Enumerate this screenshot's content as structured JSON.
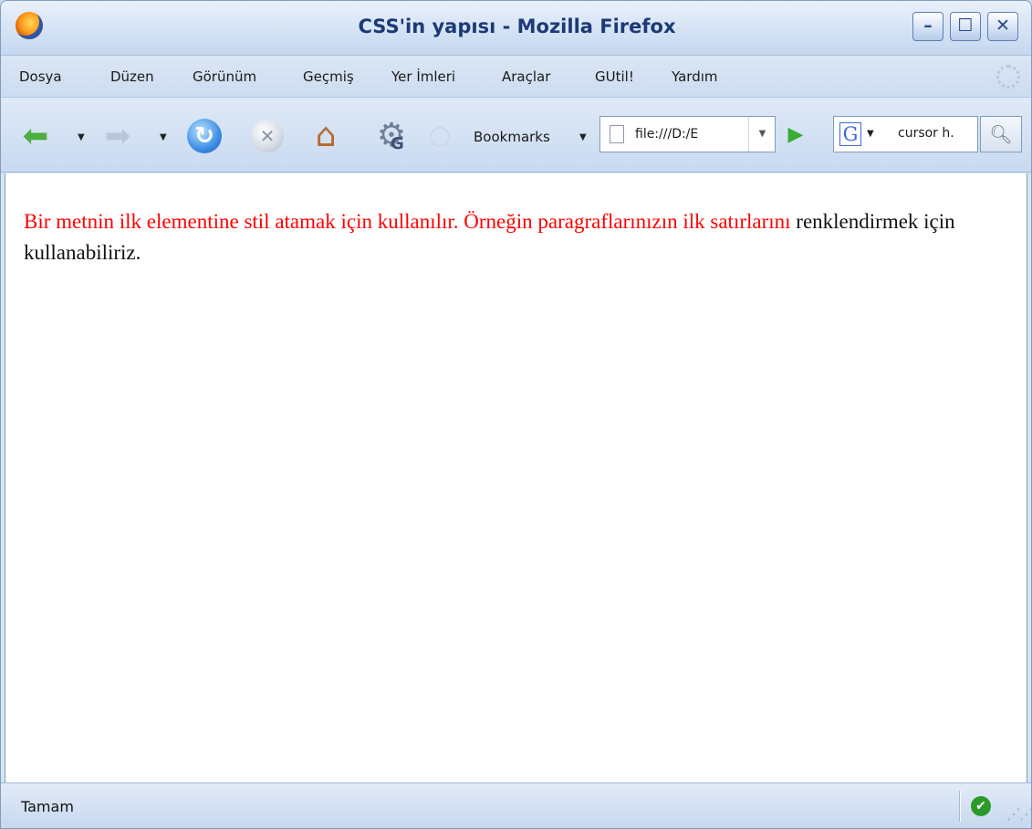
{
  "window": {
    "title": "CSS'in yapısı - Mozilla Firefox",
    "minimize_label": "–",
    "maximize_label": "☐",
    "close_label": "✕"
  },
  "menu": {
    "items": [
      {
        "label": "Dosya"
      },
      {
        "label": "Düzen"
      },
      {
        "label": "Görünüm"
      },
      {
        "label": "Geçmiş"
      },
      {
        "label": "Yer İmleri"
      },
      {
        "label": "Araçlar"
      },
      {
        "label": "GUtil!"
      },
      {
        "label": "Yardım"
      }
    ]
  },
  "toolbar": {
    "icons": [
      "back-icon",
      "forward-icon",
      "reload-icon",
      "stop-icon",
      "home-icon",
      "gutil-gear-icon",
      "bookmarks-loading-icon",
      "go-icon",
      "google-icon",
      "magnifier-icon"
    ],
    "bookmarks_label": "Bookmarks",
    "address_value": "file:///D:/E",
    "search_engine_letter": "G",
    "search_value": "cursor h."
  },
  "content": {
    "first_line": "Bir metnin ilk elementine stil atamak için kullanılır. Örneğin paragraflarınızın ilk satırlarını",
    "rest": " renklendirmek için kullanabiliriz.",
    "first_line_color": "#ff0000"
  },
  "status": {
    "text": "Tamam"
  }
}
